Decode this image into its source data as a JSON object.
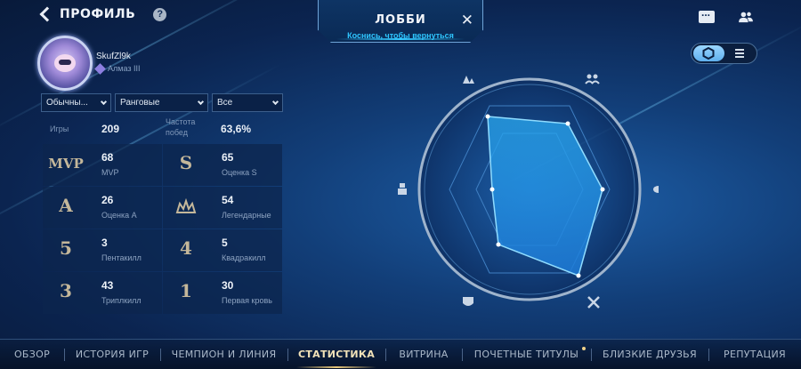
{
  "header": {
    "title": "ПРОФИЛЬ",
    "help": "?"
  },
  "lobby": {
    "title": "ЛОББИ",
    "subtitle": "Коснись, чтобы вернуться"
  },
  "profile": {
    "username": "SkufZl9k",
    "rank": "Алмаз III"
  },
  "filters": [
    {
      "label": "Обычны..."
    },
    {
      "label": "Ранговые"
    },
    {
      "label": "Все"
    }
  ],
  "summary": {
    "games_label": "Игры",
    "games_value": "209",
    "winrate_label": "Частота побед",
    "winrate_value": "63,6%"
  },
  "stats": [
    {
      "icon": "MVP",
      "value": "68",
      "label": "MVP"
    },
    {
      "icon": "S",
      "value": "65",
      "label": "Оценка S"
    },
    {
      "icon": "A",
      "value": "26",
      "label": "Оценка A"
    },
    {
      "icon": "legendary-crown",
      "value": "54",
      "label": "Легендарные"
    },
    {
      "icon": "5",
      "value": "3",
      "label": "Пентакилл"
    },
    {
      "icon": "4",
      "value": "5",
      "label": "Квадракилл"
    },
    {
      "icon": "3",
      "value": "43",
      "label": "Триплкилл"
    },
    {
      "icon": "1",
      "value": "30",
      "label": "Первая кровь"
    }
  ],
  "radar": {
    "axes": [
      "farm",
      "teamfight",
      "kda",
      "vision",
      "damage",
      "survival"
    ]
  },
  "nav": {
    "tabs": [
      {
        "label": "ОБЗОР",
        "active": false
      },
      {
        "label": "ИСТОРИЯ ИГР",
        "active": false
      },
      {
        "label": "ЧЕМПИОН И ЛИНИЯ",
        "active": false
      },
      {
        "label": "СТАТИСТИКА",
        "active": true
      },
      {
        "label": "ВИТРИНА",
        "active": false
      },
      {
        "label": "ПОЧЕТНЫЕ ТИТУЛЫ",
        "active": false
      },
      {
        "label": "БЛИЗКИЕ ДРУЗЬЯ",
        "active": false
      },
      {
        "label": "РЕПУТАЦИЯ",
        "active": false
      }
    ]
  },
  "colors": {
    "accent": "#2fc6ff",
    "gold": "#e8c87a",
    "bg": "#123e78"
  }
}
